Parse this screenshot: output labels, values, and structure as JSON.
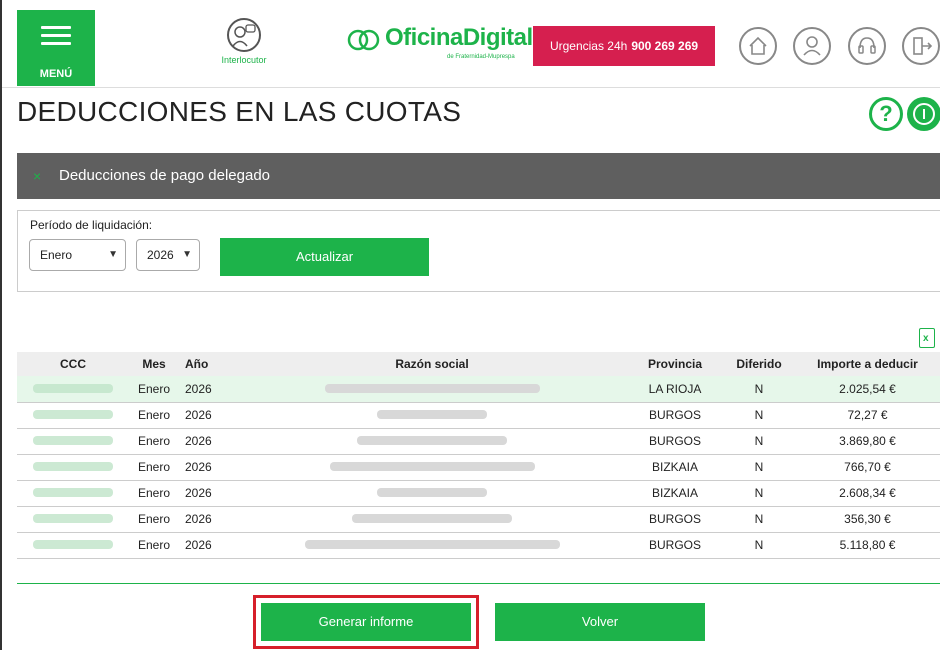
{
  "header": {
    "menu_label": "MENÚ",
    "interlocutor_label": "Interlocutor",
    "logo_name": "OficinaDigital",
    "logo_sub": "de Fraternidad-Muprespa",
    "urgent_text": "Urgencias 24h",
    "urgent_phone": "900 269 269",
    "icons": [
      "home-icon",
      "user-icon",
      "headset-icon",
      "logout-icon"
    ]
  },
  "page": {
    "title": "DEDUCCIONES EN LAS CUOTAS",
    "help_symbol": "?"
  },
  "section": {
    "close_symbol": "×",
    "title": "Deducciones de pago delegado"
  },
  "filter": {
    "label": "Período de liquidación:",
    "month_value": "Enero",
    "year_value": "2026",
    "update_button": "Actualizar"
  },
  "table": {
    "columns": [
      "CCC",
      "Mes",
      "Año",
      "Razón social",
      "Provincia",
      "Diferido",
      "Importe a deducir"
    ],
    "rows": [
      {
        "mes": "Enero",
        "ano": "2026",
        "provincia": "LA RIOJA",
        "diferido": "N",
        "importe": "2.025,54 €"
      },
      {
        "mes": "Enero",
        "ano": "2026",
        "provincia": "BURGOS",
        "diferido": "N",
        "importe": "72,27 €"
      },
      {
        "mes": "Enero",
        "ano": "2026",
        "provincia": "BURGOS",
        "diferido": "N",
        "importe": "3.869,80 €"
      },
      {
        "mes": "Enero",
        "ano": "2026",
        "provincia": "BIZKAIA",
        "diferido": "N",
        "importe": "766,70 €"
      },
      {
        "mes": "Enero",
        "ano": "2026",
        "provincia": "BIZKAIA",
        "diferido": "N",
        "importe": "2.608,34 €"
      },
      {
        "mes": "Enero",
        "ano": "2026",
        "provincia": "BURGOS",
        "diferido": "N",
        "importe": "356,30 €"
      },
      {
        "mes": "Enero",
        "ano": "2026",
        "provincia": "BURGOS",
        "diferido": "N",
        "importe": "5.118,80 €"
      }
    ]
  },
  "footer": {
    "generate_button": "Generar informe",
    "back_button": "Volver"
  },
  "colors": {
    "brand_green": "#1db34a",
    "urgent_red": "#d61f4f",
    "section_gray": "#5f5f5f",
    "highlight_row": "#e6f7ea",
    "annotation_red": "#d61f2a"
  }
}
